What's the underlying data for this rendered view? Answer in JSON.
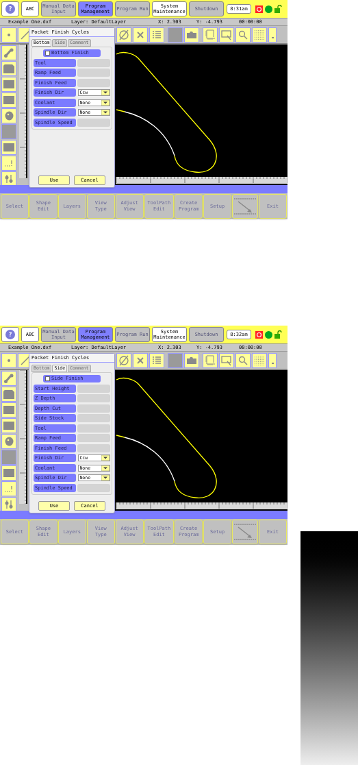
{
  "screens": [
    {
      "top_buttons": [
        {
          "label": "?",
          "kind": "round",
          "disabled": false,
          "selected": false
        },
        {
          "label": "ABC",
          "kind": "text",
          "disabled": false,
          "selected": false
        },
        {
          "label": "Manual Data Input",
          "kind": "text",
          "disabled": true,
          "selected": false
        },
        {
          "label": "Program Management",
          "kind": "text",
          "disabled": false,
          "selected": true
        },
        {
          "label": "Program Run",
          "kind": "text",
          "disabled": true,
          "selected": false
        },
        {
          "label": "System Maintenance",
          "kind": "text",
          "disabled": false,
          "selected": false
        },
        {
          "label": "Shutdown",
          "kind": "text",
          "disabled": true,
          "selected": false
        }
      ],
      "clock": "8:31am",
      "info": {
        "file": "Example One.dxf",
        "layer": "Layer: DefaultLayer",
        "x": "X:  2.303",
        "y": "Y:  -4.793",
        "timer": "00:00:00"
      },
      "dialog": {
        "title": "Pocket Finish Cycles",
        "tabs": [
          {
            "label": "Bottom",
            "selected": true
          },
          {
            "label": "Side",
            "selected": false
          },
          {
            "label": "Comment",
            "selected": false
          }
        ],
        "checkbox": {
          "label": "Bottom Finish",
          "checked": false
        },
        "fields": [
          {
            "label": "Tool",
            "kind": "input"
          },
          {
            "label": "Ramp Feed",
            "kind": "input"
          },
          {
            "label": "Finish Feed",
            "kind": "input"
          },
          {
            "label": "Finish Dir",
            "kind": "dropdown",
            "value": "Ccw"
          },
          {
            "label": "Coolant",
            "kind": "dropdown",
            "value": "None"
          },
          {
            "label": "Spindle Dir",
            "kind": "dropdown",
            "value": "None"
          },
          {
            "label": "Spindle Speed",
            "kind": "input"
          }
        ],
        "buttons": [
          "Use",
          "Cancel"
        ]
      },
      "bottom_buttons": [
        {
          "kind": "text",
          "label": "Select"
        },
        {
          "kind": "text",
          "label": "Shape Edit"
        },
        {
          "kind": "text",
          "label": "Layers"
        },
        {
          "kind": "text",
          "label": "View Type"
        },
        {
          "kind": "text",
          "label": "Adjust View"
        },
        {
          "kind": "text",
          "label": "ToolPath Edit"
        },
        {
          "kind": "text",
          "label": "Create Program"
        },
        {
          "kind": "text",
          "label": "Setup"
        },
        {
          "kind": "icon"
        },
        {
          "kind": "text",
          "label": "Exit"
        }
      ]
    },
    {
      "top_buttons": [
        {
          "label": "?",
          "kind": "round",
          "disabled": false,
          "selected": false
        },
        {
          "label": "ABC",
          "kind": "text",
          "disabled": false,
          "selected": false
        },
        {
          "label": "Manual Data Input",
          "kind": "text",
          "disabled": true,
          "selected": false
        },
        {
          "label": "Program Management",
          "kind": "text",
          "disabled": false,
          "selected": true
        },
        {
          "label": "Program Run",
          "kind": "text",
          "disabled": true,
          "selected": false
        },
        {
          "label": "System Maintenance",
          "kind": "text",
          "disabled": false,
          "selected": false
        },
        {
          "label": "Shutdown",
          "kind": "text",
          "disabled": true,
          "selected": false
        }
      ],
      "clock": "8:32am",
      "info": {
        "file": "Example One.dxf",
        "layer": "Layer: DefaultLayer",
        "x": "X:  2.303",
        "y": "Y:  -4.793",
        "timer": "00:00:00"
      },
      "dialog": {
        "title": "Pocket Finish Cycles",
        "tabs": [
          {
            "label": "Bottom",
            "selected": false
          },
          {
            "label": "Side",
            "selected": true
          },
          {
            "label": "Comment",
            "selected": false
          }
        ],
        "checkbox": {
          "label": "Side Finish",
          "checked": false
        },
        "fields": [
          {
            "label": "Start Height",
            "kind": "input"
          },
          {
            "label": "Z Depth",
            "kind": "input"
          },
          {
            "label": "Depth Cut",
            "kind": "input"
          },
          {
            "label": "Side Stock",
            "kind": "input"
          },
          {
            "label": "Tool",
            "kind": "input"
          },
          {
            "label": "Ramp Feed",
            "kind": "input"
          },
          {
            "label": "Finish Feed",
            "kind": "input"
          },
          {
            "label": "Finish Dir",
            "kind": "dropdown",
            "value": "Ccw"
          },
          {
            "label": "Coolant",
            "kind": "dropdown",
            "value": "None"
          },
          {
            "label": "Spindle Dir",
            "kind": "dropdown",
            "value": "None"
          },
          {
            "label": "Spindle Speed",
            "kind": "input"
          }
        ],
        "buttons": [
          "Use",
          "Cancel"
        ]
      },
      "bottom_buttons": [
        {
          "kind": "text",
          "label": "Select"
        },
        {
          "kind": "text",
          "label": "Shape Edit"
        },
        {
          "kind": "text",
          "label": "Layers"
        },
        {
          "kind": "text",
          "label": "View Type"
        },
        {
          "kind": "text",
          "label": "Adjust View"
        },
        {
          "kind": "text",
          "label": "ToolPath Edit"
        },
        {
          "kind": "text",
          "label": "Create Program"
        },
        {
          "kind": "text",
          "label": "Setup"
        },
        {
          "kind": "icon"
        },
        {
          "kind": "text",
          "label": "Exit"
        }
      ]
    }
  ]
}
